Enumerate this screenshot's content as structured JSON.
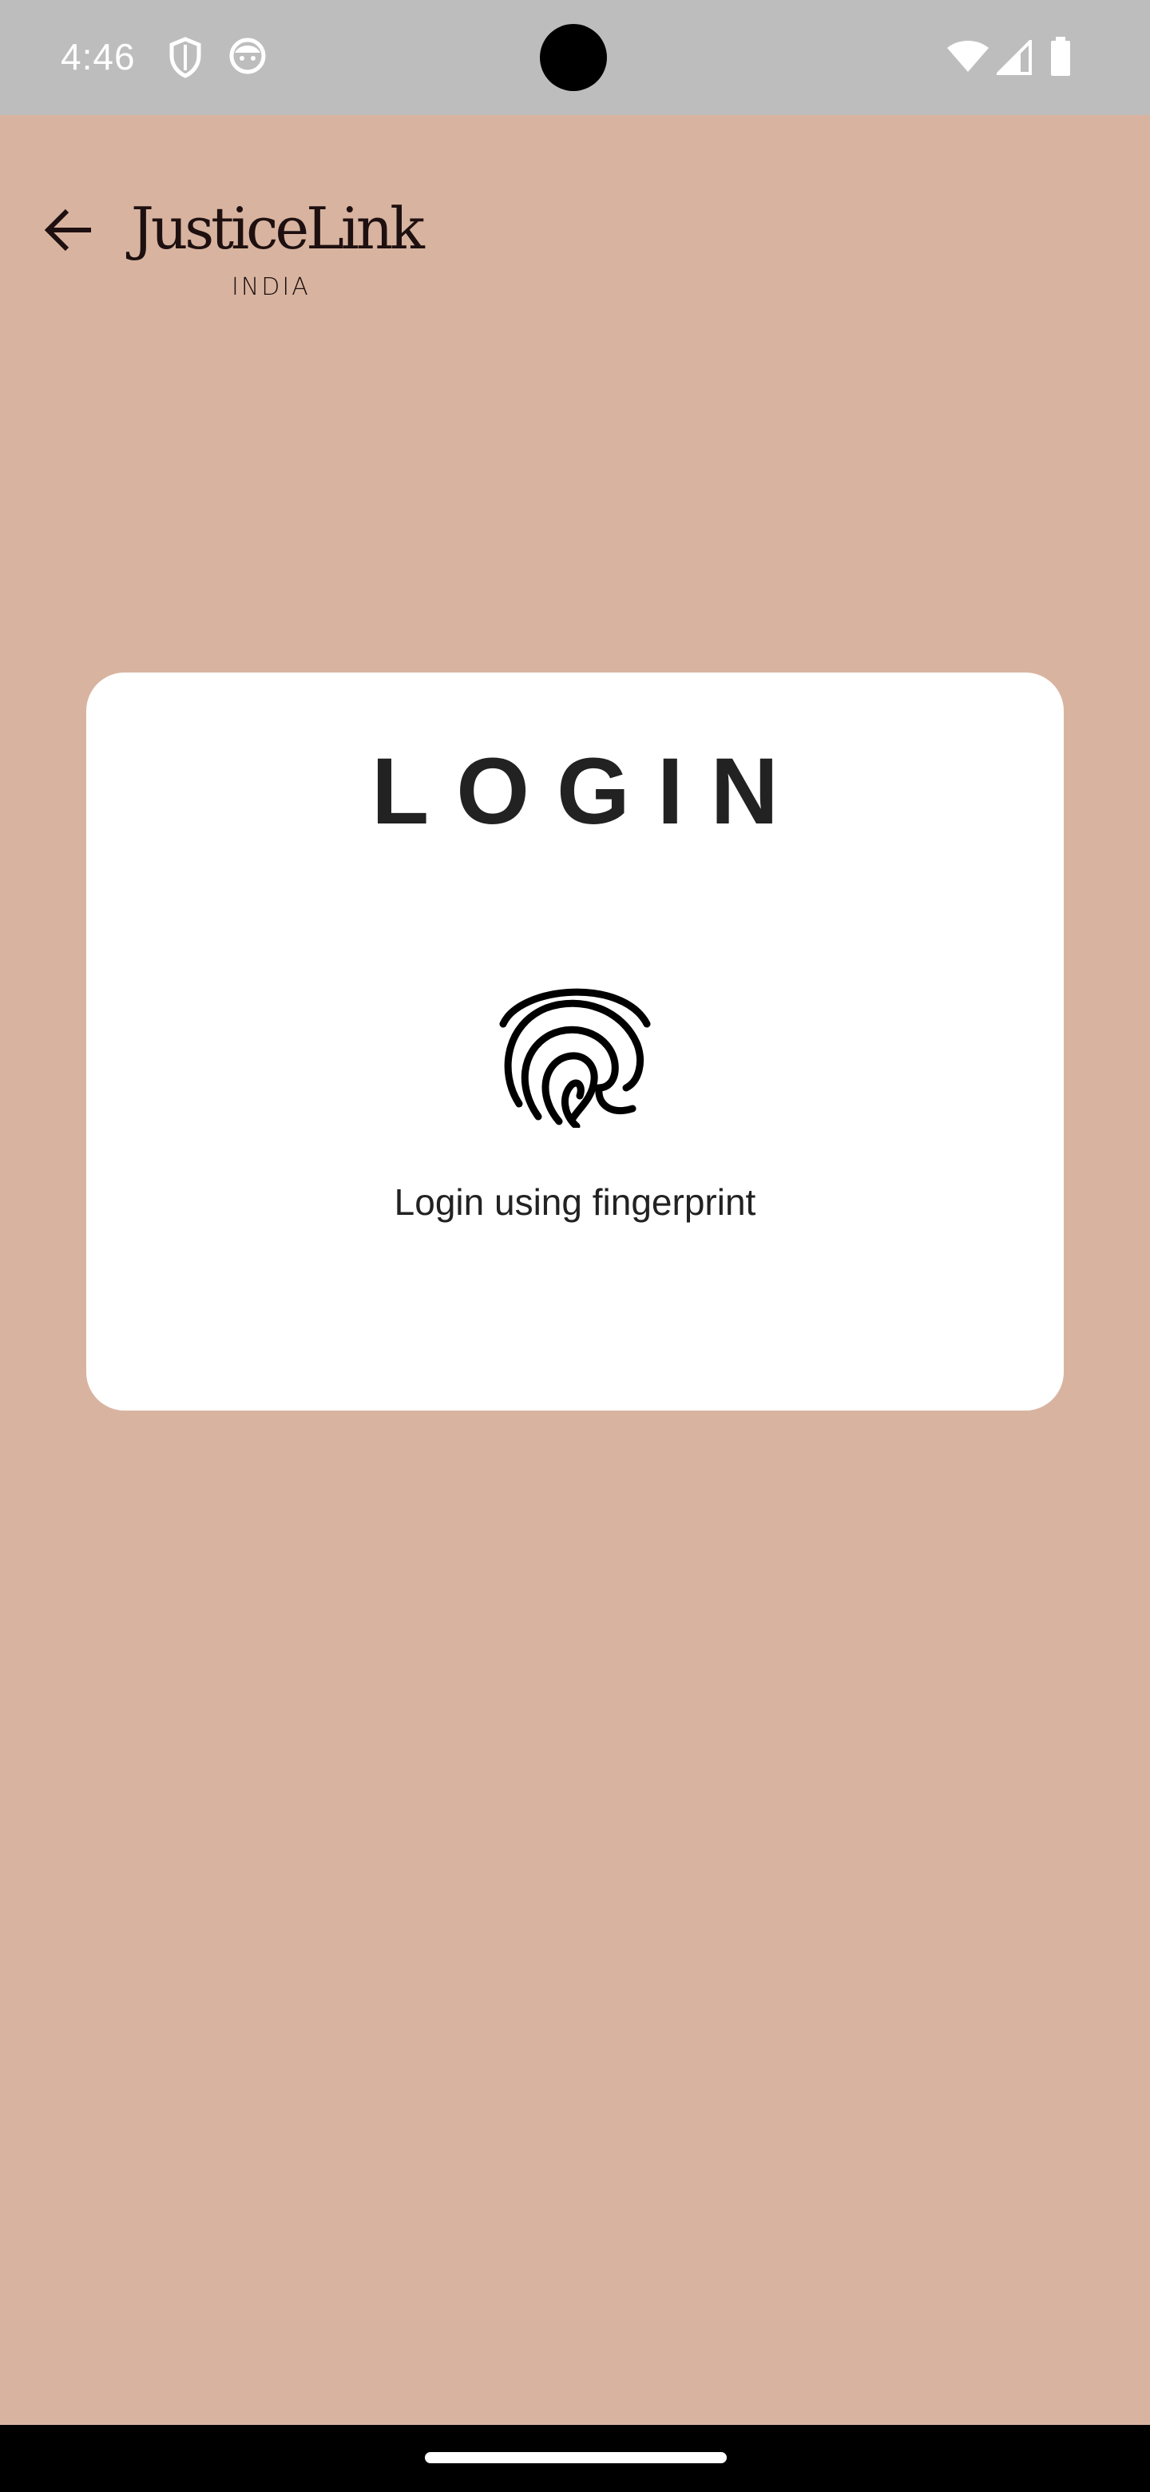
{
  "status_bar": {
    "time": "4:46",
    "left_icons": [
      "shield-icon",
      "face-icon"
    ],
    "right_icons": [
      "wifi-icon",
      "signal-icon",
      "battery-icon"
    ]
  },
  "header": {
    "back_icon": "arrow-back-icon",
    "logo_main": "JusticeLink",
    "logo_sub": "INDIA"
  },
  "card": {
    "title": "LOGIN",
    "fingerprint_icon": "fingerprint-icon",
    "fingerprint_label": "Login using fingerprint"
  },
  "colors": {
    "background": "#D8B4A0",
    "status_bar": "#BDBDBD",
    "card": "#FFFFFF",
    "text": "#222222"
  }
}
